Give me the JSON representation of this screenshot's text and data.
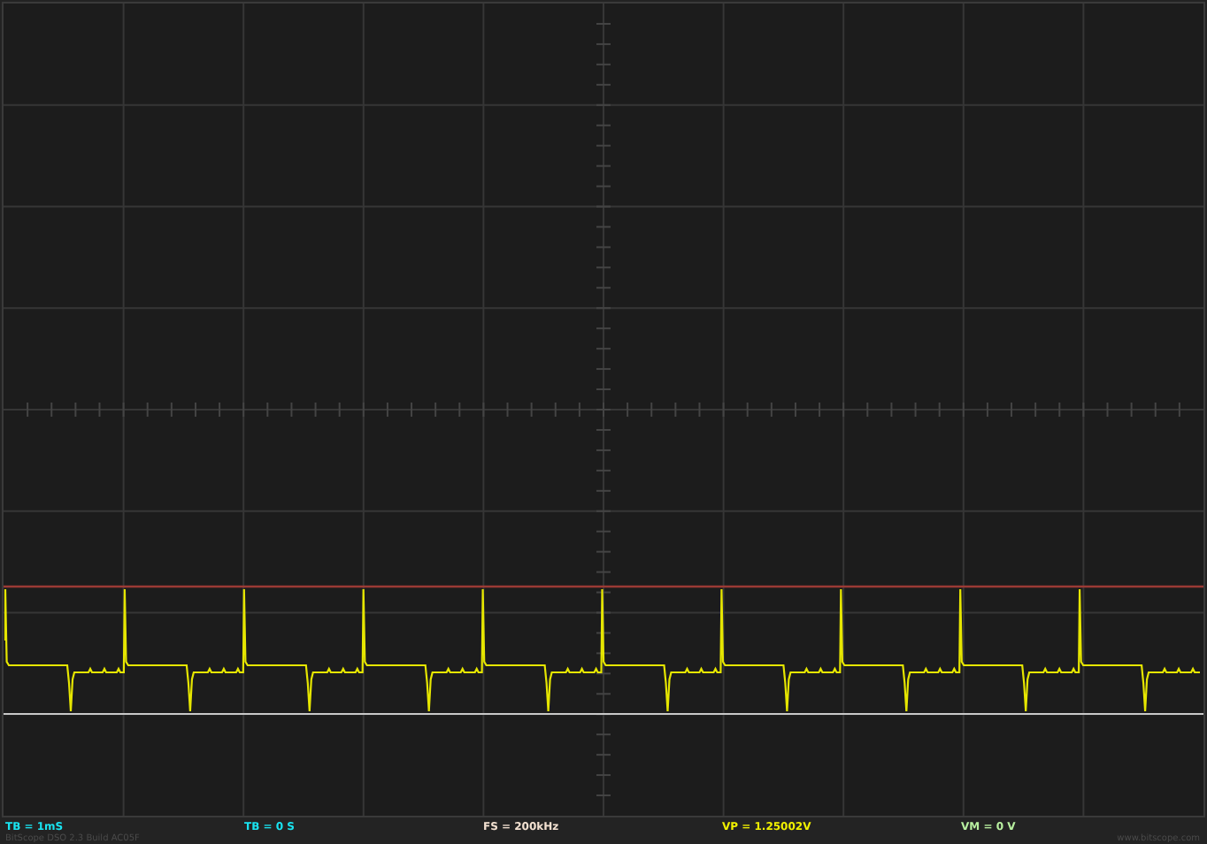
{
  "status_bar": [
    {
      "label": "TB = 1mS",
      "color": "#19e3f0"
    },
    {
      "label": "TB = 0 S",
      "color": "#19e3f0"
    },
    {
      "label": "FS = 200kHz",
      "color": "#f2e0d0"
    },
    {
      "label": "VP = 1.25002V",
      "color": "#f0f000"
    },
    {
      "label": "VM = 0 V",
      "color": "#b8f0a0"
    }
  ],
  "footer": {
    "version": "BitScope DSO 2.3 Build AC05F",
    "website": "www.bitscope.com"
  }
}
